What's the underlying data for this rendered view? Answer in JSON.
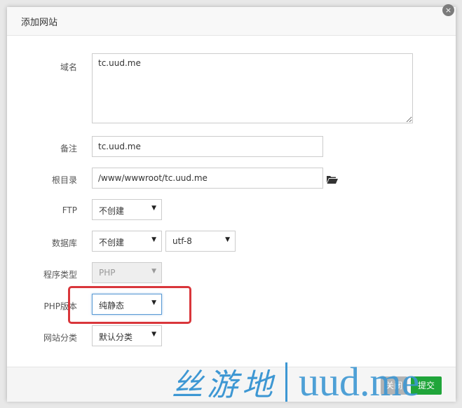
{
  "dialog": {
    "title": "添加网站",
    "close_glyph": "×"
  },
  "form": {
    "domain": {
      "label": "域名",
      "value": "tc.uud.me"
    },
    "remark": {
      "label": "备注",
      "value": "tc.uud.me"
    },
    "root_dir": {
      "label": "根目录",
      "value": "/www/wwwroot/tc.uud.me",
      "icon": "folder-open-icon"
    },
    "ftp": {
      "label": "FTP",
      "value": "不创建"
    },
    "database": {
      "label": "数据库",
      "value": "不创建",
      "charset": "utf-8"
    },
    "program_type": {
      "label": "程序类型",
      "value": "PHP"
    },
    "php_version": {
      "label": "PHP版本",
      "value": "纯静态"
    },
    "site_category": {
      "label": "网站分类",
      "value": "默认分类"
    }
  },
  "footer": {
    "close_label": "关闭",
    "submit_label": "提交"
  },
  "watermark": {
    "cn_text": "丝游地",
    "en_text": "uud.me"
  },
  "colors": {
    "highlight": "#d9363b",
    "submit": "#20a53a",
    "watermark": "#3d97d3"
  }
}
